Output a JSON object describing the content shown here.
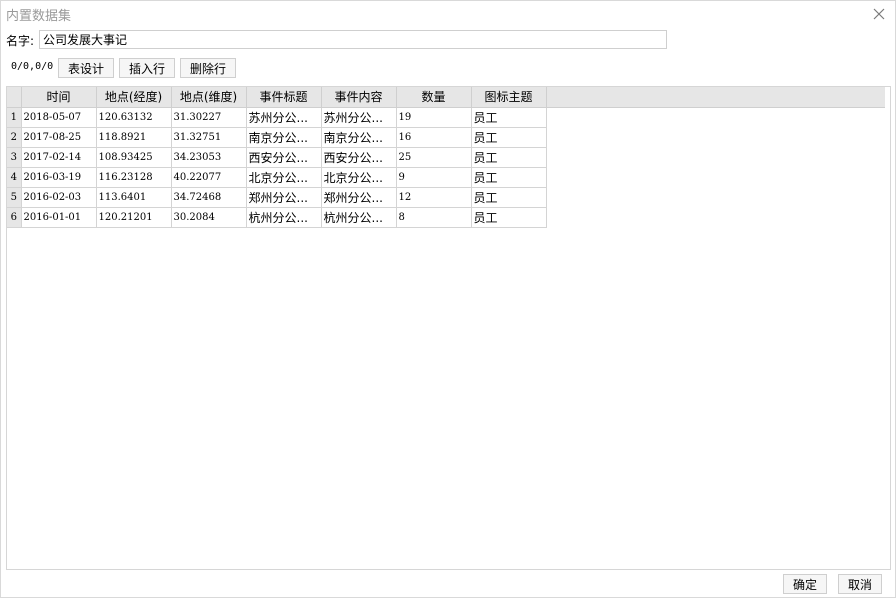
{
  "window": {
    "title": "内置数据集",
    "close_icon": "close-icon"
  },
  "name_field": {
    "label": "名字:",
    "value": "公司发展大事记"
  },
  "toolbar": {
    "counter": "0/0,0/0",
    "table_design_label": "表设计",
    "insert_row_label": "插入行",
    "delete_row_label": "删除行"
  },
  "table": {
    "columns": [
      "时间",
      "地点(经度)",
      "地点(维度)",
      "事件标题",
      "事件内容",
      "数量",
      "图标主题"
    ],
    "rows": [
      {
        "num": "1",
        "cells": [
          "2018-05-07",
          "120.63132",
          "31.30227",
          "苏州分公...",
          "苏州分公...",
          "19",
          "员工"
        ]
      },
      {
        "num": "2",
        "cells": [
          "2017-08-25",
          "118.8921",
          "31.32751",
          "南京分公...",
          "南京分公...",
          "16",
          "员工"
        ]
      },
      {
        "num": "3",
        "cells": [
          "2017-02-14",
          "108.93425",
          "34.23053",
          "西安分公...",
          "西安分公...",
          "25",
          "员工"
        ]
      },
      {
        "num": "4",
        "cells": [
          "2016-03-19",
          "116.23128",
          "40.22077",
          "北京分公...",
          "北京分公...",
          "9",
          "员工"
        ]
      },
      {
        "num": "5",
        "cells": [
          "2016-02-03",
          "113.6401",
          "34.72468",
          "郑州分公...",
          "郑州分公...",
          "12",
          "员工"
        ]
      },
      {
        "num": "6",
        "cells": [
          "2016-01-01",
          "120.21201",
          "30.2084",
          "杭州分公...",
          "杭州分公...",
          "8",
          "员工"
        ]
      }
    ]
  },
  "footer": {
    "ok_label": "确定",
    "cancel_label": "取消"
  }
}
